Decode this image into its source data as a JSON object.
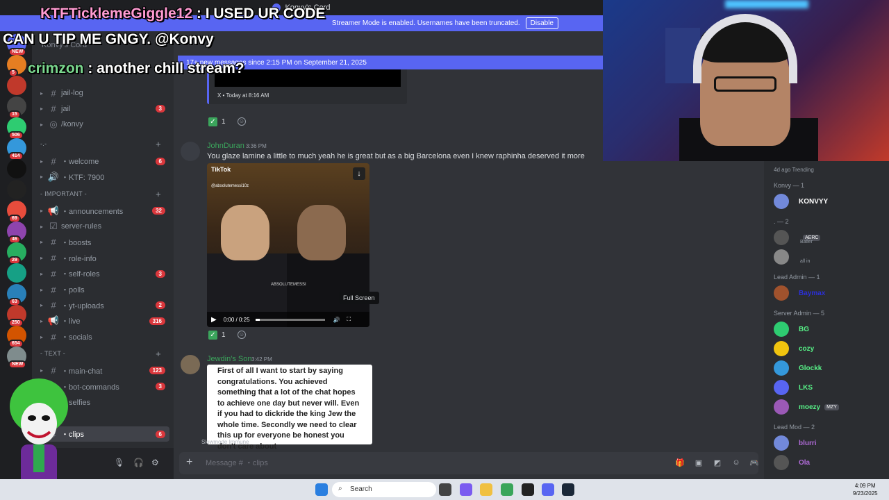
{
  "window": {
    "title": "Konvy's Cord"
  },
  "streamer_bar": {
    "text": "Streamer Mode is enabled. Usernames have been truncated.",
    "button": "Disable"
  },
  "new_messages": {
    "text": "17+ new messages since 2:15 PM on September 21, 2025"
  },
  "overlay_chat": [
    {
      "user": "KTFTicklemeGiggle12",
      "text": ": I USED UR CODE"
    },
    {
      "user": "",
      "text": "CAN U TIP ME GNGY. @Konvy"
    },
    {
      "user": "crimzon",
      "text": ": another chill stream?"
    }
  ],
  "server_rail": [
    {
      "badge": "NEW"
    },
    {
      "badge": "5"
    },
    {
      "badge": ""
    },
    {
      "badge": "15"
    },
    {
      "badge": "506"
    },
    {
      "badge": "414"
    },
    {
      "badge": ""
    },
    {
      "badge": ""
    },
    {
      "badge": "69"
    },
    {
      "badge": "46"
    },
    {
      "badge": "29"
    },
    {
      "badge": ""
    },
    {
      "badge": "63"
    },
    {
      "badge": "250"
    },
    {
      "badge": "654"
    },
    {
      "badge": "NEW"
    }
  ],
  "sidebar": {
    "server_name": "Konvy's Cord",
    "top_channels": [
      {
        "icon": "#",
        "name": "jail-log",
        "count": ""
      },
      {
        "icon": "#",
        "name": "jail",
        "count": "3"
      },
      {
        "icon": "◎",
        "name": "/konvy",
        "count": ""
      }
    ],
    "cat_misc": {
      "label": "-.-"
    },
    "misc_channels": [
      {
        "icon": "#",
        "name": "・welcome",
        "count": "6"
      },
      {
        "icon": "🔊",
        "name": "・KTF: 7900",
        "count": ""
      }
    ],
    "cat_important": {
      "label": "- IMPORTANT -"
    },
    "important_channels": [
      {
        "icon": "📢",
        "name": "・announcements",
        "count": "32"
      },
      {
        "icon": "☑",
        "name": "server-rules",
        "count": ""
      },
      {
        "icon": "#",
        "name": "・boosts",
        "count": ""
      },
      {
        "icon": "#",
        "name": "・role-info",
        "count": ""
      },
      {
        "icon": "#",
        "name": "・self-roles",
        "count": "3"
      },
      {
        "icon": "#",
        "name": "・polls",
        "count": ""
      },
      {
        "icon": "#",
        "name": "・yt-uploads",
        "count": "2"
      },
      {
        "icon": "📢",
        "name": "・live",
        "count": "316"
      },
      {
        "icon": "#",
        "name": "・socials",
        "count": ""
      }
    ],
    "cat_text": {
      "label": "- TEXT -"
    },
    "text_channels": [
      {
        "icon": "#",
        "name": "・main-chat",
        "count": "123"
      },
      {
        "icon": "#",
        "name": "・bot-commands",
        "count": "3"
      },
      {
        "icon": "#",
        "name": "・selfies",
        "count": ""
      }
    ],
    "active_channel": {
      "icon": "#",
      "name": "・clips",
      "count": "6"
    }
  },
  "messages": {
    "embed": {
      "source": "X • Today at 8:16 AM"
    },
    "reaction1": {
      "count": "1"
    },
    "msg1": {
      "user": "JohnDuran",
      "time": "3:36 PM",
      "text": "You glaze lamine a little to much yeah he is great but as a big Barcelona even I knew raphinha deserved it more"
    },
    "video": {
      "brand": "TikTok",
      "handle": "@absolutemessi10z",
      "watermark": "ABSOLUTEMESSI",
      "time": "0:00 / 0:25",
      "progress": 0.06
    },
    "fullscreen_tooltip": "Full Screen",
    "reaction2": {
      "count": "1"
    },
    "msg2": {
      "user": "Jewdin's Son",
      "time": "3:42 PM",
      "text": "First of all I want to start by saying congratulations. You achieved something that a lot of the chat hopes to achieve one day but never will. Even if you had to dickride the king Jew the whole time. Secondly we need to clear this up for everyone be honest you don't care about"
    },
    "slowmode": "Slowmode Immune"
  },
  "composer": {
    "placeholder": "Message # ・clips"
  },
  "members": {
    "trending": "4d ago  Trending",
    "groups": [
      {
        "label": "Konvy — 1",
        "members": [
          {
            "name": "KONVYY",
            "sub": "",
            "tag": "",
            "color": "#ffffff"
          }
        ]
      },
      {
        "label": ". — 2",
        "members": [
          {
            "name": "",
            "sub": "Baller",
            "tag": "AERC",
            "color": "#ffffff"
          },
          {
            "name": "",
            "sub": "all in",
            "tag": "",
            "color": "#ffffff"
          }
        ]
      },
      {
        "label": "Lead Admin — 1",
        "members": [
          {
            "name": "Baymax",
            "sub": "",
            "tag": "",
            "color": "#2b2fd6"
          }
        ]
      },
      {
        "label": "Server Admin — 5",
        "members": [
          {
            "name": "BG",
            "sub": "",
            "tag": "",
            "color": "#57f287"
          },
          {
            "name": "cozy",
            "sub": "",
            "tag": "",
            "color": "#57f287"
          },
          {
            "name": "Glockk",
            "sub": "",
            "tag": "",
            "color": "#57f287"
          },
          {
            "name": "LKS",
            "sub": "",
            "tag": "",
            "color": "#57f287"
          },
          {
            "name": "moezy",
            "sub": "",
            "tag": "MZY",
            "color": "#57f287"
          }
        ]
      },
      {
        "label": "Lead Mod — 2",
        "members": [
          {
            "name": "blurri",
            "sub": "",
            "tag": "",
            "color": "#b06bd8"
          },
          {
            "name": "Ola",
            "sub": "",
            "tag": "",
            "color": "#b06bd8"
          }
        ]
      }
    ]
  },
  "taskbar": {
    "search": "Search",
    "time": "4:09 PM",
    "date": "9/23/2025"
  }
}
